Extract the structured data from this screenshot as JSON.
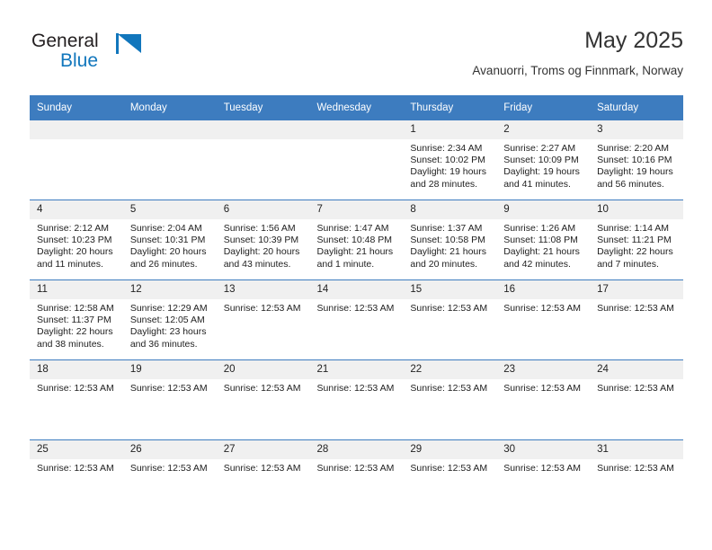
{
  "logo": {
    "word1": "General",
    "word2": "Blue",
    "triangle_icon": "blue-triangle-icon",
    "brand_color": "#1176bc"
  },
  "header": {
    "title": "May 2025",
    "subtitle": "Avanuorri, Troms og Finnmark, Norway",
    "header_bg": "#3d7cbf",
    "daynum_bg": "#f0f0f0"
  },
  "weekdays": [
    "Sunday",
    "Monday",
    "Tuesday",
    "Wednesday",
    "Thursday",
    "Friday",
    "Saturday"
  ],
  "weeks": [
    [
      {
        "day": "",
        "lines": []
      },
      {
        "day": "",
        "lines": []
      },
      {
        "day": "",
        "lines": []
      },
      {
        "day": "",
        "lines": []
      },
      {
        "day": "1",
        "lines": [
          "Sunrise: 2:34 AM",
          "Sunset: 10:02 PM",
          "Daylight: 19 hours",
          "and 28 minutes."
        ]
      },
      {
        "day": "2",
        "lines": [
          "Sunrise: 2:27 AM",
          "Sunset: 10:09 PM",
          "Daylight: 19 hours",
          "and 41 minutes."
        ]
      },
      {
        "day": "3",
        "lines": [
          "Sunrise: 2:20 AM",
          "Sunset: 10:16 PM",
          "Daylight: 19 hours",
          "and 56 minutes."
        ]
      }
    ],
    [
      {
        "day": "4",
        "lines": [
          "Sunrise: 2:12 AM",
          "Sunset: 10:23 PM",
          "Daylight: 20 hours",
          "and 11 minutes."
        ]
      },
      {
        "day": "5",
        "lines": [
          "Sunrise: 2:04 AM",
          "Sunset: 10:31 PM",
          "Daylight: 20 hours",
          "and 26 minutes."
        ]
      },
      {
        "day": "6",
        "lines": [
          "Sunrise: 1:56 AM",
          "Sunset: 10:39 PM",
          "Daylight: 20 hours",
          "and 43 minutes."
        ]
      },
      {
        "day": "7",
        "lines": [
          "Sunrise: 1:47 AM",
          "Sunset: 10:48 PM",
          "Daylight: 21 hours",
          "and 1 minute."
        ]
      },
      {
        "day": "8",
        "lines": [
          "Sunrise: 1:37 AM",
          "Sunset: 10:58 PM",
          "Daylight: 21 hours",
          "and 20 minutes."
        ]
      },
      {
        "day": "9",
        "lines": [
          "Sunrise: 1:26 AM",
          "Sunset: 11:08 PM",
          "Daylight: 21 hours",
          "and 42 minutes."
        ]
      },
      {
        "day": "10",
        "lines": [
          "Sunrise: 1:14 AM",
          "Sunset: 11:21 PM",
          "Daylight: 22 hours",
          "and 7 minutes."
        ]
      }
    ],
    [
      {
        "day": "11",
        "lines": [
          "Sunrise: 12:58 AM",
          "Sunset: 11:37 PM",
          "Daylight: 22 hours",
          "and 38 minutes."
        ]
      },
      {
        "day": "12",
        "lines": [
          "Sunrise: 12:29 AM",
          "Sunset: 12:05 AM",
          "Daylight: 23 hours",
          "and 36 minutes."
        ]
      },
      {
        "day": "13",
        "lines": [
          "Sunrise: 12:53 AM"
        ]
      },
      {
        "day": "14",
        "lines": [
          "Sunrise: 12:53 AM"
        ]
      },
      {
        "day": "15",
        "lines": [
          "Sunrise: 12:53 AM"
        ]
      },
      {
        "day": "16",
        "lines": [
          "Sunrise: 12:53 AM"
        ]
      },
      {
        "day": "17",
        "lines": [
          "Sunrise: 12:53 AM"
        ]
      }
    ],
    [
      {
        "day": "18",
        "lines": [
          "Sunrise: 12:53 AM"
        ]
      },
      {
        "day": "19",
        "lines": [
          "Sunrise: 12:53 AM"
        ]
      },
      {
        "day": "20",
        "lines": [
          "Sunrise: 12:53 AM"
        ]
      },
      {
        "day": "21",
        "lines": [
          "Sunrise: 12:53 AM"
        ]
      },
      {
        "day": "22",
        "lines": [
          "Sunrise: 12:53 AM"
        ]
      },
      {
        "day": "23",
        "lines": [
          "Sunrise: 12:53 AM"
        ]
      },
      {
        "day": "24",
        "lines": [
          "Sunrise: 12:53 AM"
        ]
      }
    ],
    [
      {
        "day": "25",
        "lines": [
          "Sunrise: 12:53 AM"
        ]
      },
      {
        "day": "26",
        "lines": [
          "Sunrise: 12:53 AM"
        ]
      },
      {
        "day": "27",
        "lines": [
          "Sunrise: 12:53 AM"
        ]
      },
      {
        "day": "28",
        "lines": [
          "Sunrise: 12:53 AM"
        ]
      },
      {
        "day": "29",
        "lines": [
          "Sunrise: 12:53 AM"
        ]
      },
      {
        "day": "30",
        "lines": [
          "Sunrise: 12:53 AM"
        ]
      },
      {
        "day": "31",
        "lines": [
          "Sunrise: 12:53 AM"
        ]
      }
    ]
  ]
}
